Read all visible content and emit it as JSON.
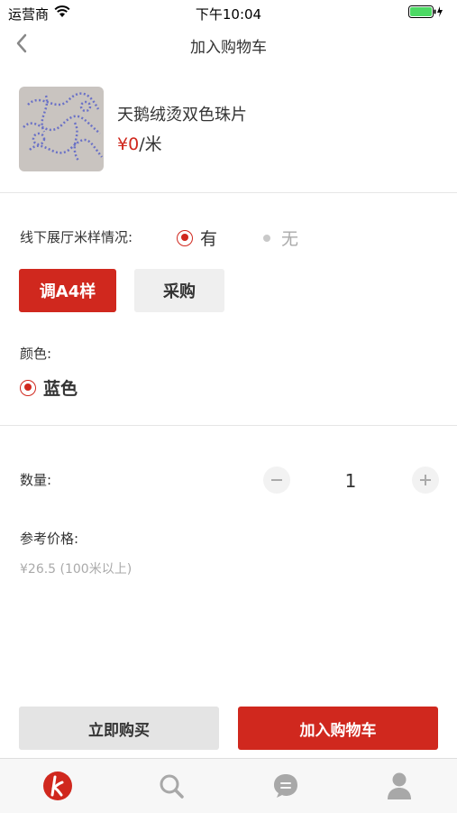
{
  "status_bar": {
    "carrier": "运营商",
    "time": "下午10:04"
  },
  "nav": {
    "title": "加入购物车"
  },
  "product": {
    "name": "天鹅绒烫双色珠片",
    "currency": "¥0",
    "unit": "/米"
  },
  "sample_section": {
    "label": "线下展厅米样情况:",
    "options": [
      {
        "label": "有",
        "selected": true
      },
      {
        "label": "无",
        "selected": false,
        "disabled": true
      }
    ]
  },
  "actions_top": {
    "a4_label": "调A4样",
    "purchase_label": "采购"
  },
  "color_section": {
    "label": "颜色:",
    "selected_color": "蓝色"
  },
  "quantity": {
    "label": "数量:",
    "value": "1"
  },
  "reference_price": {
    "label": "参考价格:",
    "value": "¥26.5 (100米以上)"
  },
  "bottom_actions": {
    "buy_now": "立即购买",
    "add_to_cart": "加入购物车"
  },
  "colors": {
    "accent": "#d0281e",
    "disabled": "#c9c9c9"
  },
  "tabs": [
    {
      "icon": "brand-logo-icon"
    },
    {
      "icon": "search-icon"
    },
    {
      "icon": "chat-icon"
    },
    {
      "icon": "profile-icon"
    }
  ]
}
